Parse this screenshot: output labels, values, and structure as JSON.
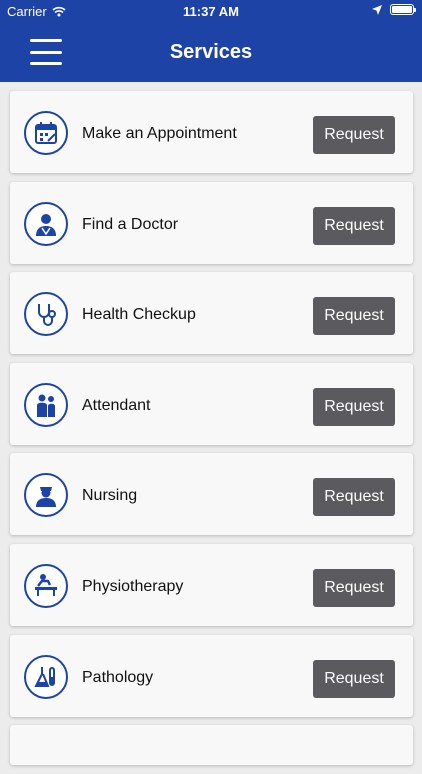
{
  "status_bar": {
    "carrier": "Carrier",
    "time": "11:37 AM",
    "battery_level": 1.0
  },
  "header": {
    "title": "Services",
    "menu_icon": "hamburger-menu-icon"
  },
  "colors": {
    "header": "#1d43a6",
    "button": "#5a5a5f",
    "background": "#ececec"
  },
  "services": [
    {
      "label": "Make an Appointment",
      "icon": "calendar-icon",
      "button": "Request"
    },
    {
      "label": "Find a Doctor",
      "icon": "doctor-icon",
      "button": "Request"
    },
    {
      "label": "Health Checkup",
      "icon": "stethoscope-icon",
      "button": "Request"
    },
    {
      "label": "Attendant",
      "icon": "attendant-icon",
      "button": "Request"
    },
    {
      "label": "Nursing",
      "icon": "nurse-icon",
      "button": "Request"
    },
    {
      "label": "Physiotherapy",
      "icon": "physiotherapy-icon",
      "button": "Request"
    },
    {
      "label": "Pathology",
      "icon": "lab-flask-icon",
      "button": "Request"
    }
  ]
}
